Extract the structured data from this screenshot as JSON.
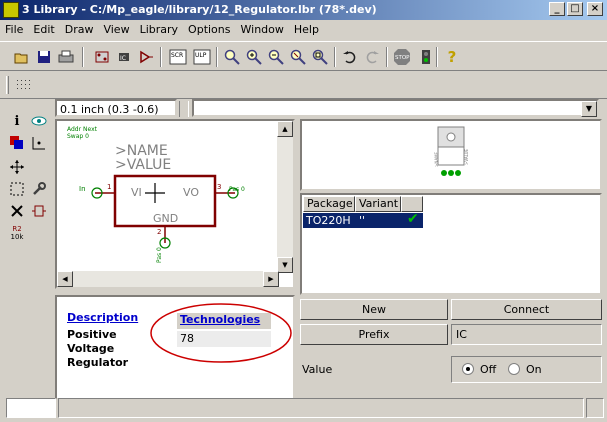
{
  "window": {
    "title": "3 Library - C:/Mp_eagle/library/12_Regulator.lbr (78*.dev)",
    "buttons": [
      "_",
      "□",
      "×"
    ]
  },
  "menu": [
    {
      "label": "File"
    },
    {
      "label": "Edit"
    },
    {
      "label": "Draw"
    },
    {
      "label": "View"
    },
    {
      "label": "Library"
    },
    {
      "label": "Options"
    },
    {
      "label": "Window"
    },
    {
      "label": "Help"
    }
  ],
  "toolbar": {
    "script_label": "SCR",
    "ulp_label": "ULP",
    "stop_label": "STOP",
    "help_label": "?"
  },
  "lefttools": {
    "r2_label": "R2",
    "r2_value": "10k"
  },
  "coordinate": "0.1 inch (0.3 -0.6)",
  "command": "",
  "symbol": {
    "add_text": "Addr Next",
    "swap_text": "Swap 0",
    "name_label": ">NAME",
    "value_label": ">VALUE",
    "pin_vi": "VI",
    "pin_vo": "VO",
    "pin_gnd": "GND",
    "num_in": "1",
    "num_out": "3",
    "num_gnd": "2",
    "in_text": "In",
    "pas_left": "Pas 0",
    "pas_right": "Pas 0",
    "pas_bottom": "Pas 0"
  },
  "preview": {
    "name_text": ">NAME",
    "value_text": ">VALUE"
  },
  "package_table": {
    "headers": [
      "Package",
      "Variant"
    ],
    "rows": [
      {
        "package": "TO220H",
        "variant": "''",
        "check": "✔"
      }
    ]
  },
  "description": {
    "header": "Description",
    "text_lines": [
      "Positive",
      "Voltage",
      "Regulator"
    ]
  },
  "technologies": {
    "header": "Technologies",
    "value": "78"
  },
  "buttons": {
    "new": "New",
    "connect": "Connect",
    "prefix": "Prefix",
    "prefix_value": "IC"
  },
  "value_row": {
    "label": "Value",
    "off": "Off",
    "on": "On",
    "selected": "Off"
  },
  "colors": {
    "symbol_outline": "#800000",
    "pin_green": "#008000",
    "selection": "#0a246a",
    "annotation_red": "#cc0000"
  }
}
